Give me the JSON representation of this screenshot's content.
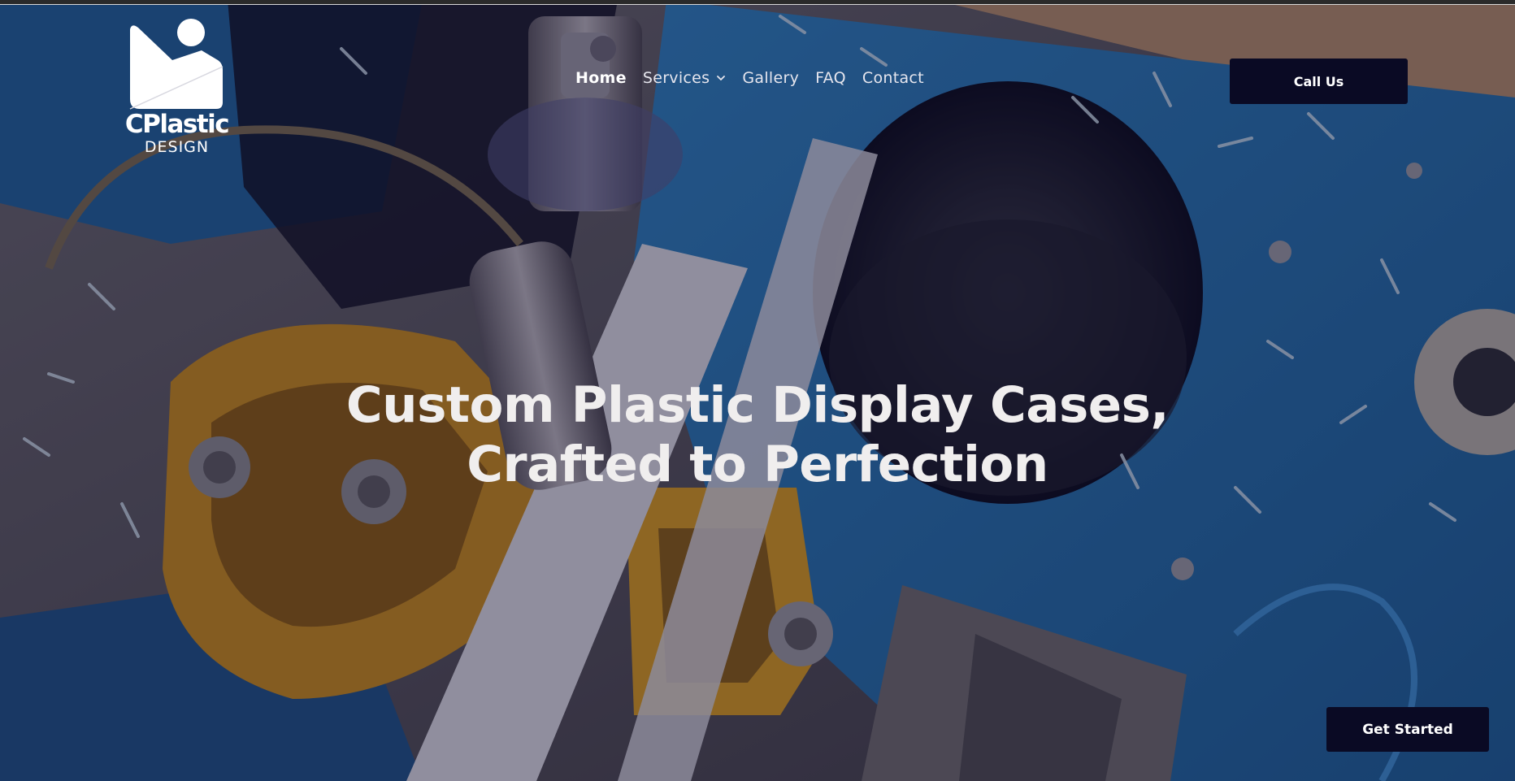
{
  "logo": {
    "wordmark": "CPlastic",
    "subtitle": "DESIGN",
    "color": "#ffffff"
  },
  "nav": {
    "items": [
      {
        "label": "Home",
        "active": true
      },
      {
        "label": "Services",
        "has_dropdown": true
      },
      {
        "label": "Gallery"
      },
      {
        "label": "FAQ"
      },
      {
        "label": "Contact"
      }
    ]
  },
  "header": {
    "call_button_label": "Call Us"
  },
  "hero": {
    "title_line1": "Custom Plastic Display Cases,",
    "title_line2": "Crafted to Perfection",
    "background_icon": "cnc-machine-photo"
  },
  "cta": {
    "get_started_label": "Get Started"
  },
  "colors": {
    "button_bg": "#0a0a24",
    "nav_text": "#e6e6ee",
    "hero_text": "#f0eeee",
    "machine_blue": "#1f6fb2",
    "machine_orange": "#c98a1a"
  }
}
